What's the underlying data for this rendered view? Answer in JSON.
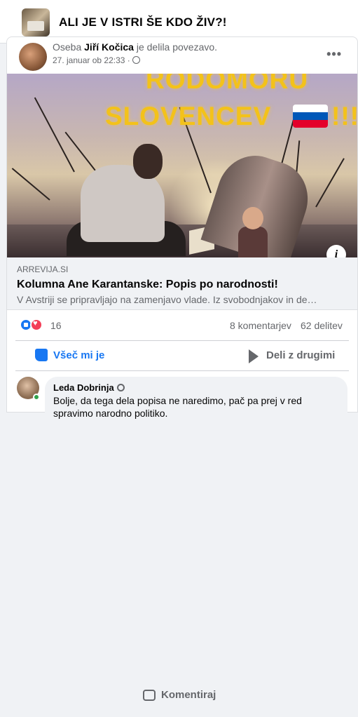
{
  "group": {
    "title": "ALI JE V ISTRI ŠE KDO ŽIV?!"
  },
  "post": {
    "sharer_prefix": "Oseba",
    "sharer_name": "Jiří Kočica",
    "sharer_suffix": "je delila povezavo.",
    "date": "27. januar ob 22:33 ·",
    "more_label": "•••"
  },
  "hero": {
    "line1": "RODOMORU",
    "line2": "SLOVENCEV",
    "exclaim": "!!!",
    "flag_colors": [
      "#ffffff",
      "#0057b8",
      "#e4002b"
    ],
    "info_label": "i"
  },
  "link": {
    "domain": "ARREVIJA.SI",
    "title": "Kolumna Ane Karantanske: Popis po narodnosti!",
    "description": "V Avstriji se pripravljajo na zamenjavo vlade. Iz svobodnjakov in de…"
  },
  "stats": {
    "reactions": "16",
    "comments": "8 komentarjev",
    "shares": "62 delitev"
  },
  "actions": {
    "like": "Všeč mi je",
    "comment": "Komentiraj",
    "share": "Deli z drugimi"
  },
  "comment": {
    "author": "Leda Dobrinja",
    "text": "Bolje, da tega dela popisa ne naredimo, pač pa prej v red spravimo narodno politiko."
  }
}
